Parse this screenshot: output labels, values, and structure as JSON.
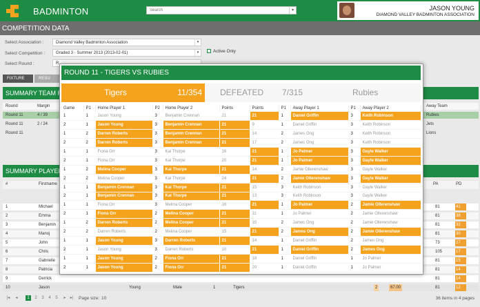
{
  "app": {
    "brand": "BADMINTON",
    "search_placeholder": "Search",
    "title": "COMPETITION DATA"
  },
  "user": {
    "name": "JASON YOUNG",
    "org": "DIAMOND VALLEY BADMINTON ASSOCIATION"
  },
  "colors": {
    "accent": "#1e8c45",
    "win": "#f5a21c",
    "header_bar": "#6e6e6e"
  },
  "filters": {
    "association_label": "Select Association :",
    "association_value": "Diamond Valley Badminton Association",
    "competition_label": "Select Competition :",
    "competition_value": "Graded 3 - Summer 2013 (2013-02-01)",
    "round_label": "Select Round :",
    "round_value": "R",
    "active_only": "Active Only"
  },
  "tabs": [
    "FIXTURE",
    "RESU"
  ],
  "team_summary": {
    "title": "SUMMARY TEAM RE",
    "col_round": "Round",
    "col_margin": "Margin",
    "col_away": "Away Team",
    "rows": [
      {
        "round": "Round 11",
        "margin": "4 / 39",
        "away": "Rubies"
      },
      {
        "round": "Round 11",
        "margin": "2 / 24",
        "away": "Jets"
      },
      {
        "round": "Round 11",
        "margin": "",
        "away": "Lions"
      }
    ]
  },
  "player_summary": {
    "title": "SUMMARY PLAYER R",
    "col_hash": "#",
    "col_firstname": "Firstname",
    "col_pa": "PA",
    "col_pd": "PD",
    "rows": [
      {
        "no": "1",
        "first": "Michael",
        "pa": "81",
        "pd": "41"
      },
      {
        "no": "2",
        "first": "Emma",
        "pa": "81",
        "pd": "38"
      },
      {
        "no": "3",
        "first": "Benjamin",
        "pa": "81",
        "pd": "32"
      },
      {
        "no": "4",
        "first": "Manoj",
        "pa": "81",
        "pd": "30"
      },
      {
        "no": "5",
        "first": "John",
        "pa": "73",
        "pd": "27"
      },
      {
        "no": "6",
        "first": "Chris",
        "pa": "105",
        "pd": "17"
      },
      {
        "no": "7",
        "first": "Gabrielle",
        "pa": "81",
        "pd": "15"
      },
      {
        "no": "8",
        "first": "Patricia",
        "pa": "81",
        "pd": "14"
      },
      {
        "no": "9",
        "first": "Derrick",
        "pa": "81",
        "pd": "14"
      },
      {
        "no": "10",
        "first": "Jason",
        "last": "Young",
        "gender": "Male",
        "played": "1",
        "team": "Tigers",
        "extra": "2",
        "pct": "67.00",
        "pa": "81",
        "pd": "12"
      }
    ]
  },
  "pager": {
    "pages": [
      "1",
      "2",
      "3",
      "4",
      "5"
    ],
    "size_label": "Page size:",
    "size_value": "10",
    "info": "36 items in 4 pages"
  },
  "modal": {
    "title": "ROUND 11 - TIGERS VS RUBIES",
    "home": "Tigers",
    "home_score": "11/354",
    "result": "DEFEATED",
    "away_score": "7/315",
    "away": "Rubies",
    "headers": [
      "Game",
      "P1",
      "Home Player 1",
      "P2",
      "Home Player 2",
      "Points",
      "Points",
      "P1",
      "Away Player 1",
      "P1",
      "Away Player 2"
    ],
    "rows": [
      [
        "1",
        "1",
        "Jason Young",
        "3",
        "Benjamin Crennan",
        "21",
        "21",
        "1",
        "Daniel Griffin",
        "3",
        "Keith Robinson",
        "A"
      ],
      [
        "2",
        "1",
        "Jason Young",
        "3",
        "Benjamin Crennan",
        "21",
        "9",
        "1",
        "Daniel Griffin",
        "3",
        "Keith Robinson",
        "H"
      ],
      [
        "1",
        "2",
        "Darren Roberts",
        "3",
        "Benjamin Crennan",
        "21",
        "14",
        "2",
        "James Ong",
        "3",
        "Keith Robinson",
        "H"
      ],
      [
        "2",
        "2",
        "Darren Roberts",
        "3",
        "Benjamin Crennan",
        "21",
        "17",
        "2",
        "James Ong",
        "3",
        "Keith Robinson",
        "H"
      ],
      [
        "1",
        "1",
        "Fiona Orr",
        "3",
        "Kai Thorpe",
        "16",
        "21",
        "1",
        "Jo Palmer",
        "3",
        "Gayle Walker",
        "A"
      ],
      [
        "2",
        "1",
        "Fiona Orr",
        "3",
        "Kai Thorpe",
        "20",
        "21",
        "1",
        "Jo Palmer",
        "3",
        "Gayle Walker",
        "A"
      ],
      [
        "1",
        "2",
        "Melina Cooper",
        "3",
        "Kai Thorpe",
        "21",
        "14",
        "2",
        "Jamie Ollerenshaw",
        "3",
        "Gayle Walker",
        "H"
      ],
      [
        "2",
        "2",
        "Melina Cooper",
        "3",
        "Kai Thorpe",
        "24",
        "21",
        "2",
        "Jamie Ollerenshaw",
        "3",
        "Gayle Walker",
        "A"
      ],
      [
        "1",
        "1",
        "Benjamin Crennan",
        "3",
        "Kai Thorpe",
        "21",
        "15",
        "3",
        "Keith Robinson",
        "3",
        "Gayle Walker",
        "H"
      ],
      [
        "2",
        "1",
        "Benjamin Crennan",
        "3",
        "Kai Thorpe",
        "21",
        "13",
        "3",
        "Keith Robinson",
        "3",
        "Gayle Walker",
        "H"
      ],
      [
        "1",
        "1",
        "Fiona Orr",
        "3",
        "Melina Cooper",
        "16",
        "21",
        "1",
        "Jo Palmer",
        "2",
        "Jamie Ollerenshaw",
        "A"
      ],
      [
        "2",
        "1",
        "Fiona Orr",
        "2",
        "Melina Cooper",
        "21",
        "11",
        "1",
        "Jo Palmer",
        "2",
        "Jamie Ollerenshaw",
        "H"
      ],
      [
        "1",
        "2",
        "Darren Roberts",
        "2",
        "Melina Cooper",
        "21",
        "15",
        "2",
        "James Ong",
        "2",
        "Jamie Ollerenshaw",
        "H"
      ],
      [
        "2",
        "2",
        "Darren Roberts",
        "2",
        "Melina Cooper",
        "15",
        "21",
        "2",
        "James Ong",
        "2",
        "Jamie Ollerenshaw",
        "A"
      ],
      [
        "1",
        "1",
        "Jason Young",
        "3",
        "Darren Roberts",
        "21",
        "14",
        "1",
        "Daniel Griffin",
        "2",
        "James Ong",
        "H"
      ],
      [
        "2",
        "1",
        "Jason Young",
        "3",
        "Darren Roberts",
        "10",
        "21",
        "1",
        "Daniel Griffin",
        "2",
        "James Ong",
        "A"
      ],
      [
        "1",
        "1",
        "Jason Young",
        "2",
        "Fiona Orr",
        "21",
        "18",
        "1",
        "Daniel Griffin",
        "1",
        "Jo Palmer",
        "H"
      ],
      [
        "2",
        "1",
        "Jason Young",
        "2",
        "Fiona Orr",
        "21",
        "20",
        "1",
        "Daniel Griffin",
        "1",
        "Jo Palmer",
        "H"
      ]
    ]
  }
}
